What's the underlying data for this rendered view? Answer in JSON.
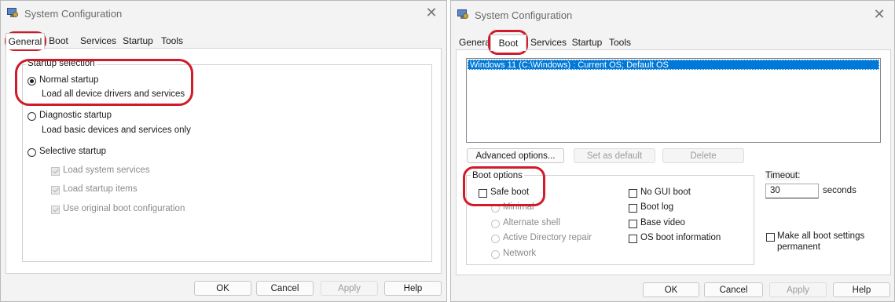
{
  "general_window": {
    "title": "System Configuration",
    "close_glyph": "✕",
    "tabs": [
      "General",
      "Boot",
      "Services",
      "Startup",
      "Tools"
    ],
    "active_tab": "General",
    "startup_selection_label": "Startup selection",
    "normal_startup": {
      "label": "Normal startup",
      "description": "Load all device drivers and services",
      "checked": true
    },
    "diagnostic_startup": {
      "label": "Diagnostic startup",
      "description": "Load basic devices and services only",
      "checked": false
    },
    "selective_startup": {
      "label": "Selective startup",
      "checked": false
    },
    "selective_options": [
      {
        "label": "Load system services",
        "checked": true,
        "enabled": false
      },
      {
        "label": "Load startup items",
        "checked": true,
        "enabled": false
      },
      {
        "label": "Use original boot configuration",
        "checked": true,
        "enabled": false
      }
    ],
    "buttons": {
      "ok": "OK",
      "cancel": "Cancel",
      "apply": "Apply",
      "help": "Help"
    }
  },
  "boot_window": {
    "title": "System Configuration",
    "close_glyph": "✕",
    "tabs": [
      "Genera",
      "Boot",
      "Services",
      "Startup",
      "Tools"
    ],
    "active_tab": "Boot",
    "os_list": [
      "Windows 11 (C:\\Windows) : Current OS; Default OS"
    ],
    "advanced_options_button": "Advanced options...",
    "set_default_button": "Set as default",
    "delete_button": "Delete",
    "boot_options_label": "Boot options",
    "safe_boot": {
      "label": "Safe boot",
      "checked": false
    },
    "safe_boot_modes": [
      {
        "label": "Minimal",
        "enabled": false
      },
      {
        "label": "Alternate shell",
        "enabled": false
      },
      {
        "label": "Active Directory repair",
        "enabled": false
      },
      {
        "label": "Network",
        "enabled": false
      }
    ],
    "right_options": [
      {
        "label": "No GUI boot",
        "checked": false
      },
      {
        "label": "Boot log",
        "checked": false
      },
      {
        "label": "Base video",
        "checked": false
      },
      {
        "label": "OS boot information",
        "checked": false
      }
    ],
    "timeout_label": "Timeout:",
    "timeout_value": "30",
    "timeout_unit": "seconds",
    "make_permanent": {
      "label_line1": "Make all boot settings",
      "label_line2": "permanent",
      "checked": false
    },
    "buttons": {
      "ok": "OK",
      "cancel": "Cancel",
      "apply": "Apply",
      "help": "Help"
    }
  },
  "annotation_color": "#d11a2a"
}
